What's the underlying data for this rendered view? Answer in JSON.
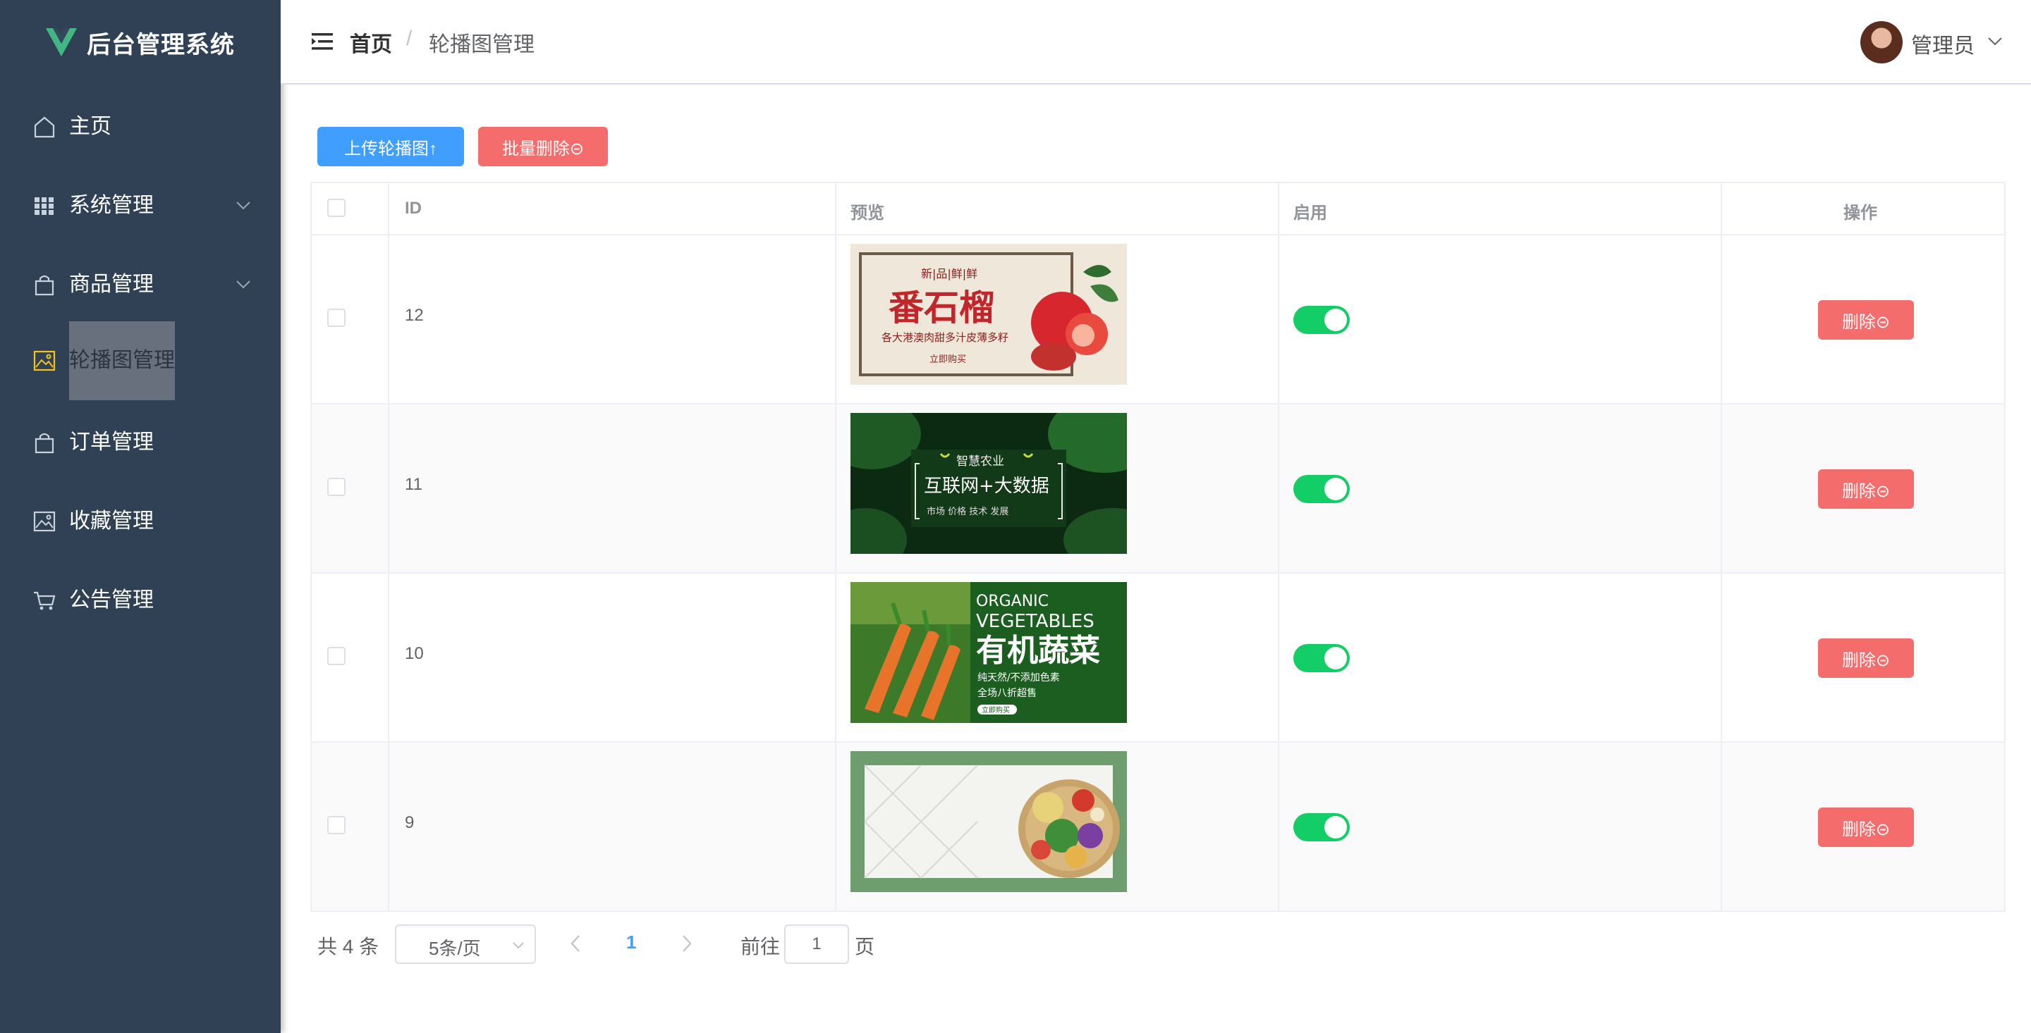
{
  "brand": {
    "title": "后台管理系统",
    "logo_color": "#41b883"
  },
  "sidebar": {
    "items": [
      {
        "label": "主页",
        "icon": "home-icon",
        "has_arrow": false
      },
      {
        "label": "系统管理",
        "icon": "grid-icon",
        "has_arrow": true
      },
      {
        "label": "商品管理",
        "icon": "bag-icon",
        "has_arrow": true
      },
      {
        "label": "轮播图管理",
        "icon": "picture-icon",
        "has_arrow": false,
        "active": true
      },
      {
        "label": "订单管理",
        "icon": "bag-icon",
        "has_arrow": false
      },
      {
        "label": "收藏管理",
        "icon": "picture-icon",
        "has_arrow": false
      },
      {
        "label": "公告管理",
        "icon": "cart-icon",
        "has_arrow": false
      }
    ]
  },
  "header": {
    "breadcrumb_home": "首页",
    "breadcrumb_sep": "/",
    "breadcrumb_current": "轮播图管理",
    "user_name": "管理员"
  },
  "toolbar": {
    "upload_label": "上传轮播图↑",
    "batch_delete_label": "批量删除⊝"
  },
  "table": {
    "columns": [
      "ID",
      "预览",
      "启用",
      "操作"
    ],
    "rows": [
      {
        "id": "12",
        "enabled": true,
        "delete_label": "删除⊝",
        "preview": {
          "kind": "pomegranate",
          "tagline": "新|品|鲜|鲜",
          "title": "番石榴",
          "sub": "各大港澳肉甜多汁皮薄多籽",
          "cta": "立即购买"
        }
      },
      {
        "id": "11",
        "enabled": true,
        "delete_label": "删除⊝",
        "preview": {
          "kind": "agri",
          "tagline": "智慧农业",
          "title": "互联网+大数据",
          "sub": "市场   价格   技术   发展"
        }
      },
      {
        "id": "10",
        "enabled": true,
        "delete_label": "删除⊝",
        "preview": {
          "kind": "veg",
          "tagline": "ORGANIC",
          "title_en": "VEGETABLES",
          "title": "有机蔬菜",
          "sub": "纯天然/不添加色素",
          "sub2": "全场八折超售",
          "cta": "立即购买"
        }
      },
      {
        "id": "9",
        "enabled": true,
        "delete_label": "删除⊝",
        "preview": {
          "kind": "basket"
        }
      }
    ]
  },
  "pagination": {
    "total_text": "共 4 条",
    "page_size": "5条/页",
    "current_page": "1",
    "goto_label": "前往",
    "goto_value": "1",
    "goto_suffix": "页"
  },
  "colors": {
    "sidebar_bg": "#304156",
    "primary": "#409eff",
    "danger": "#f56c6c",
    "switch_on": "#13ce66",
    "active_icon": "#f0c419"
  }
}
